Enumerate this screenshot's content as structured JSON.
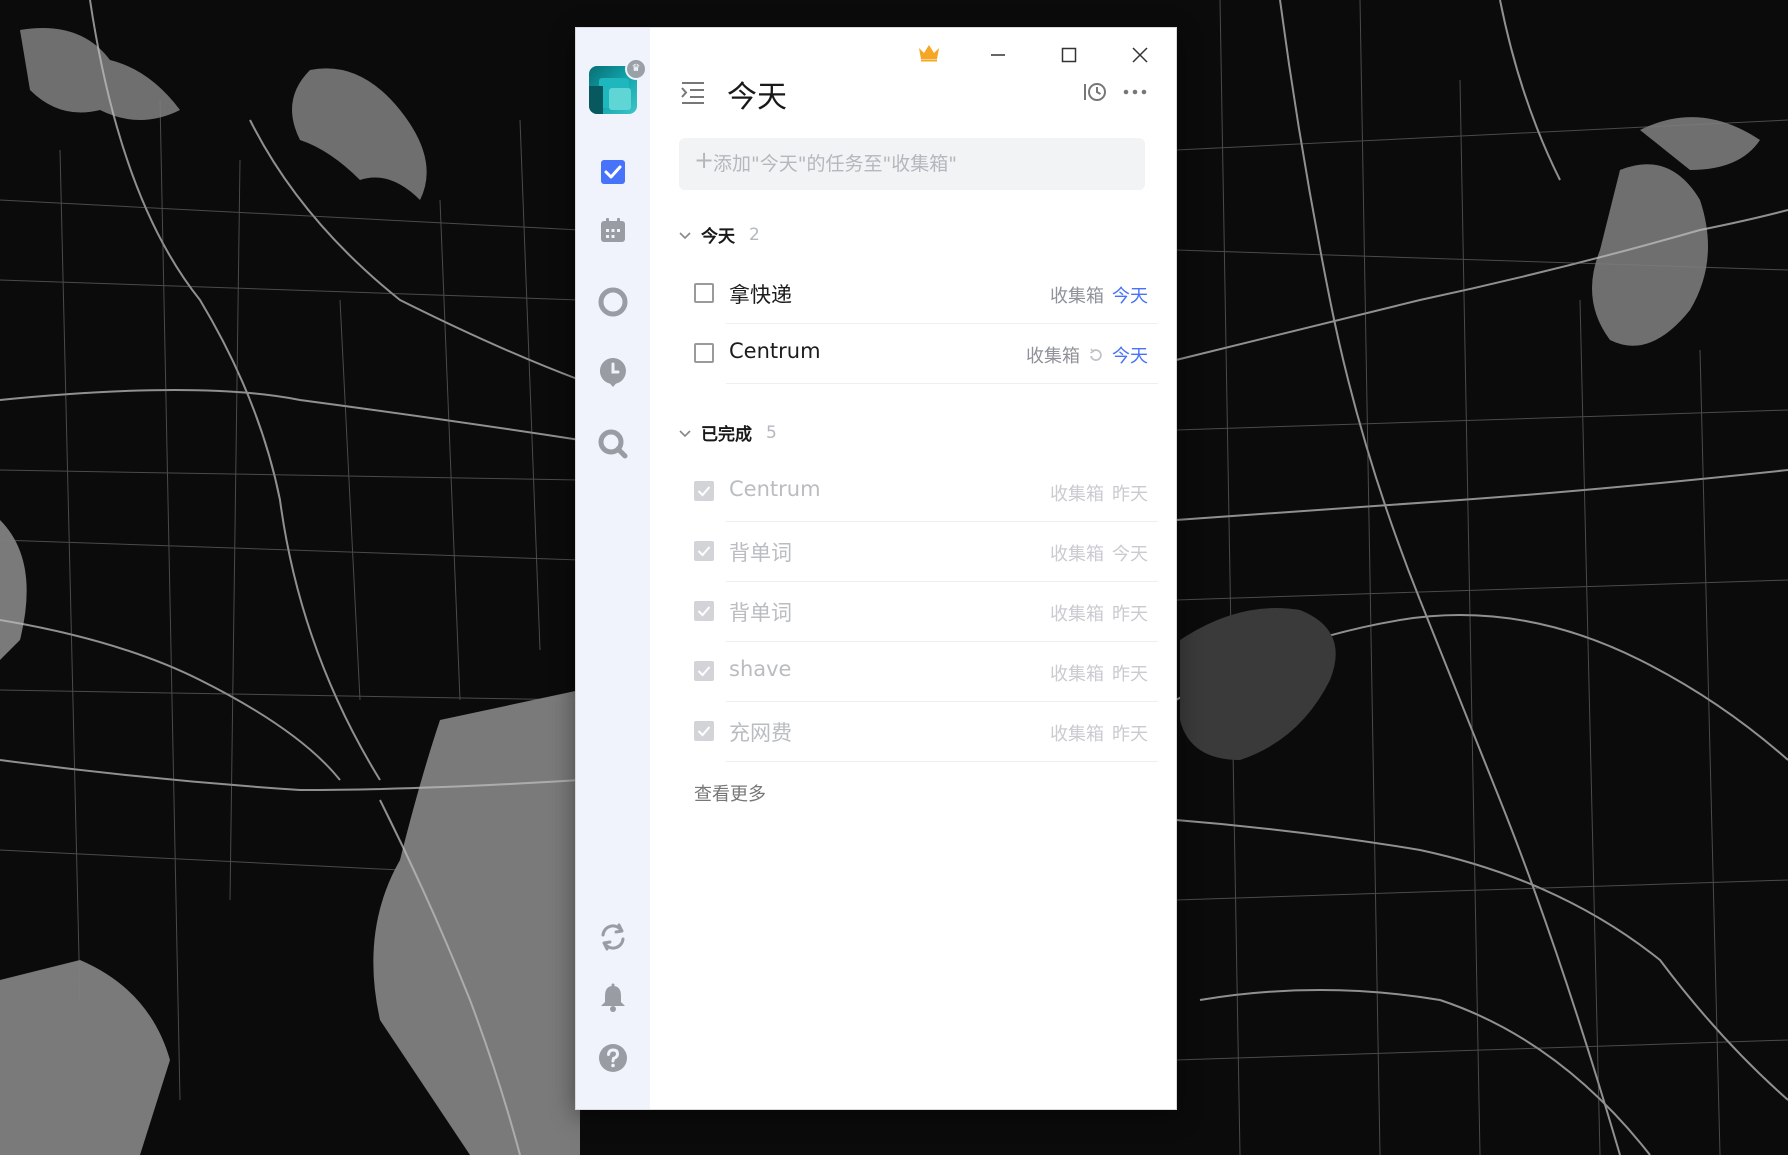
{
  "window": {
    "view_title": "今天",
    "add_task_placeholder": "添加\"今天\"的任务至\"收集箱\""
  },
  "sidebar": {
    "nav": [
      "checklist-icon",
      "calendar-icon",
      "focus-icon",
      "habit-clock-icon",
      "search-icon"
    ],
    "bottom": [
      "sync-icon",
      "bell-icon",
      "help-icon"
    ]
  },
  "sections": {
    "today": {
      "title": "今天",
      "count": "2"
    },
    "completed": {
      "title": "已完成",
      "count": "5"
    }
  },
  "tasks_today": [
    {
      "title": "拿快递",
      "project": "收集箱",
      "date": "今天",
      "repeat": false
    },
    {
      "title": "Centrum",
      "project": "收集箱",
      "date": "今天",
      "repeat": true
    }
  ],
  "tasks_completed": [
    {
      "title": "Centrum",
      "project": "收集箱",
      "date": "昨天"
    },
    {
      "title": "背单词",
      "project": "收集箱",
      "date": "今天"
    },
    {
      "title": "背单词",
      "project": "收集箱",
      "date": "昨天"
    },
    {
      "title": "shave",
      "project": "收集箱",
      "date": "昨天"
    },
    {
      "title": "充网费",
      "project": "收集箱",
      "date": "昨天"
    }
  ],
  "see_more": "查看更多",
  "colors": {
    "accent": "#4772fa",
    "premium_crown": "#f5a623",
    "sidebar_bg": "#f0f2fc",
    "desktop_bg": "#0b0b0b"
  }
}
